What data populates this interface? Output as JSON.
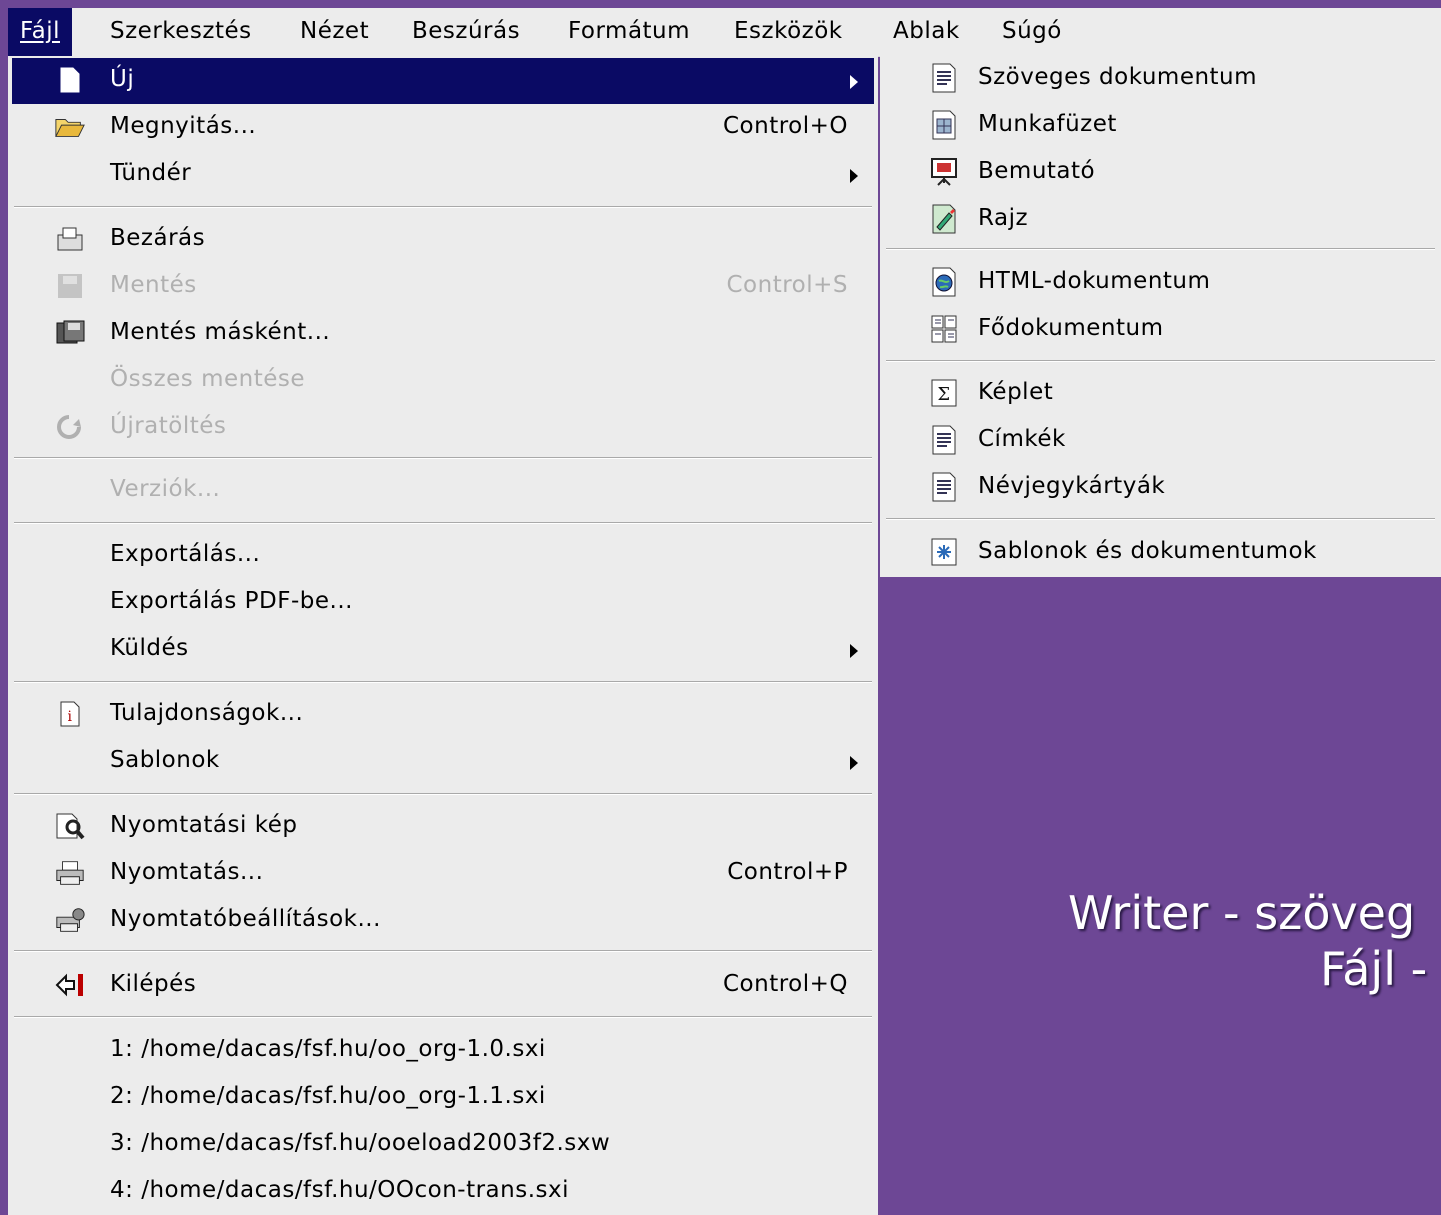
{
  "menubar": {
    "items": [
      "Fájl",
      "Szerkesztés",
      "Nézet",
      "Beszúrás",
      "Formátum",
      "Eszközök",
      "Ablak",
      "Súgó"
    ]
  },
  "file_menu": {
    "new": "Új",
    "open": "Megnyitás...",
    "open_shortcut": "Control+O",
    "wizard": "Tündér",
    "close": "Bezárás",
    "save": "Mentés",
    "save_shortcut": "Control+S",
    "save_as": "Mentés másként...",
    "save_all": "Összes mentése",
    "reload": "Újratöltés",
    "versions": "Verziók...",
    "export": "Exportálás...",
    "export_pdf": "Exportálás PDF-be...",
    "send": "Küldés",
    "properties": "Tulajdonságok...",
    "templates": "Sablonok",
    "print_preview": "Nyomtatási kép",
    "print": "Nyomtatás...",
    "print_shortcut": "Control+P",
    "printer_settings": "Nyomtatóbeállítások...",
    "exit": "Kilépés",
    "exit_shortcut": "Control+Q",
    "recent": [
      "1: /home/dacas/fsf.hu/oo_org-1.0.sxi",
      "2: /home/dacas/fsf.hu/oo_org-1.1.sxi",
      "3: /home/dacas/fsf.hu/ooeload2003f2.sxw",
      "4: /home/dacas/fsf.hu/OOcon-trans.sxi"
    ]
  },
  "new_submenu": {
    "items": [
      "Szöveges dokumentum",
      "Munkafüzet",
      "Bemutató",
      "Rajz",
      "HTML-dokumentum",
      "Fődokumentum",
      "Képlet",
      "Címkék",
      "Névjegykártyák",
      "Sablonok és dokumentumok"
    ]
  },
  "slide_text": {
    "line1": "Writer - szöveg",
    "line2": "Fájl -"
  },
  "colors": {
    "background": "#6d4795",
    "highlight": "#0a0a64",
    "menu": "#ececec"
  }
}
